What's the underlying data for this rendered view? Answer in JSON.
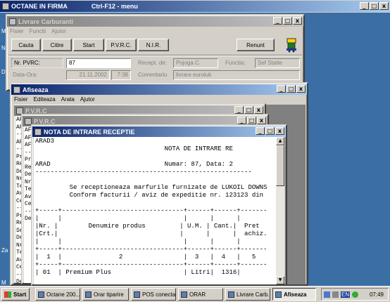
{
  "main_window": {
    "title": "OCTANE IN FIRMA",
    "title_suffix": "Ctrl-F12 - menu"
  },
  "livrare": {
    "title": "Livrare Carburanti",
    "menu": [
      "Fisier",
      "Functii",
      "Ajutor"
    ],
    "buttons": {
      "cauta": "Cauta",
      "citire": "Citire",
      "start": "Start",
      "pvrc": "P.V.R.C.",
      "nir": "N.I.R.",
      "renunt": "Renunt"
    },
    "labels": {
      "nr_pvrc": "Nr. PVRC:",
      "data_ora": "Data-Ora:",
      "recept_de": "Recept. de:",
      "comentariu": "Comentariu",
      "functia": "Functia:"
    },
    "values": {
      "nr_pvrc": "87",
      "data": "21.11.2002",
      "ora": "7:38",
      "recept_de": "Pojoga C.",
      "comentariu": "livrare euroluk",
      "functia": "Sef Statie"
    }
  },
  "afiseaza": {
    "title": "Afiseaza",
    "menu": [
      "Fisier",
      "Editeaza",
      "Arata",
      "Ajutor"
    ]
  },
  "pvrc1": {
    "title": "P.V.R.C"
  },
  "pvrc2": {
    "title": "P.V.R.C"
  },
  "nota": {
    "title": "NOTA DE INTRARE RECEPTIE",
    "lines": [
      "ARAD3",
      "                                  NOTA DE INTRARE RE",
      "",
      "ARAD                              Numar: 87, Data: 2",
      "---------------------------------------------------------",
      "",
      "         Se receptioneaza marfurile furnizate de LUKOIL DOWNS",
      "         Conform facturii / aviz de expeditie nr. 123123 din",
      "",
      "+-----+--------------------------------+------+------+-------",
      "|     |                                |      |      |",
      "|Nr. |        Denumire produs         | U.M. | Cant.|  Pret",
      "|Crt.|                                |      |      |  achiz.",
      "|     |                                |      |      |",
      "+-----+--------------------------------+------+------+-------",
      "|  1  |               2                |  3   |  4   |   5",
      "+-----+--------------------------------+------+------+-------",
      "| 01  | Premium Plus                   | Litri|  1316|"
    ]
  },
  "bg_fragments": [
    "AF",
    "AF",
    "--",
    "AF",
    "--",
    "Pr",
    "Re",
    "De",
    "Nr",
    "Te",
    "Av",
    "Ce",
    "--",
    "Pr",
    "Re",
    "Se",
    "De",
    "Nr",
    "Te",
    "Av",
    "Ce",
    "--",
    "De"
  ],
  "bg_fragments2": [
    "AF",
    "AF",
    "AF",
    "--",
    "Pr",
    "Re",
    "De",
    "Nr",
    "Te",
    "Av",
    "Ce",
    "--",
    "De"
  ],
  "desktop_letters": [
    "M",
    "N",
    "D",
    "Za",
    "M"
  ],
  "taskbar": {
    "start": "Start",
    "items": [
      "Octane 200...",
      "Orar tiparire",
      "POS conectat",
      "ORAR",
      "Livrare Carb...",
      "Afiseaza"
    ],
    "lang": "EN",
    "clock": "07:49"
  }
}
